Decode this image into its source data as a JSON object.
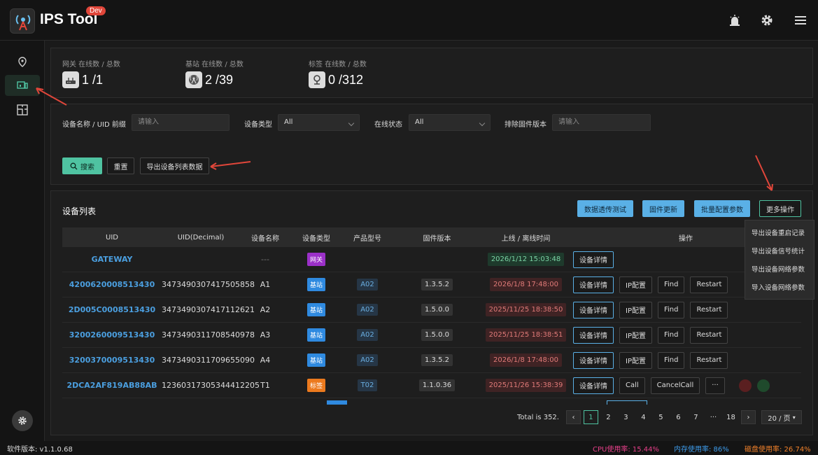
{
  "header": {
    "title": "IPS Tool",
    "badge": "Dev"
  },
  "stats": [
    {
      "label": "网关 在线数 / 总数",
      "value": "1 /1",
      "icon": "router-icon"
    },
    {
      "label": "基站 在线数 / 总数",
      "value": "2 /39",
      "icon": "antenna-icon"
    },
    {
      "label": "标签 在线数 / 总数",
      "value": "0 /312",
      "icon": "location-pin-icon"
    }
  ],
  "filters": {
    "name_label": "设备名称 / UID 前缀",
    "name_placeholder": "请输入",
    "type_label": "设备类型",
    "type_value": "All",
    "status_label": "在线状态",
    "status_value": "All",
    "fw_label": "排除固件版本",
    "fw_placeholder": "请输入",
    "search": "搜索",
    "reset": "重置",
    "export": "导出设备列表数据"
  },
  "table": {
    "title": "设备列表",
    "btn_transparent": "数据透传测试",
    "btn_firmware": "固件更新",
    "btn_batch": "批量配置参数",
    "btn_more": "更多操作",
    "columns": [
      "UID",
      "UID(Decimal)",
      "设备名称",
      "设备类型",
      "产品型号",
      "固件版本",
      "上线 / 离线时间",
      "操作"
    ],
    "rows": [
      {
        "uid": "GATEWAY",
        "dec": "",
        "name": "---",
        "type": "网关",
        "model": "",
        "fw": "",
        "time": "2026/1/12 15:03:48",
        "ops": [
          "设备详情"
        ]
      },
      {
        "uid": "4200620008513430",
        "dec": "3473490307417505858",
        "name": "A1",
        "type": "基站",
        "model": "A02",
        "fw": "1.3.5.2",
        "time": "2026/1/8 17:48:00",
        "ops": [
          "设备详情",
          "IP配置",
          "Find",
          "Restart"
        ]
      },
      {
        "uid": "2D005C0008513430",
        "dec": "3473490307417112621",
        "name": "A2",
        "type": "基站",
        "model": "A02",
        "fw": "1.5.0.0",
        "time": "2025/11/25 18:38:50",
        "ops": [
          "设备详情",
          "IP配置",
          "Find",
          "Restart"
        ]
      },
      {
        "uid": "3200260009513430",
        "dec": "3473490311708540978",
        "name": "A3",
        "type": "基站",
        "model": "A02",
        "fw": "1.5.0.0",
        "time": "2025/11/25 18:38:51",
        "ops": [
          "设备详情",
          "IP配置",
          "Find",
          "Restart"
        ]
      },
      {
        "uid": "3200370009513430",
        "dec": "3473490311709655090",
        "name": "A4",
        "type": "基站",
        "model": "A02",
        "fw": "1.3.5.2",
        "time": "2026/1/8 17:48:00",
        "ops": [
          "设备详情",
          "IP配置",
          "Find",
          "Restart"
        ]
      },
      {
        "uid": "2DCA2AF819AB88AB",
        "dec": "12360317305344412205",
        "name": "T1",
        "type": "标签",
        "model": "T02",
        "fw": "1.1.0.36",
        "time": "2025/11/26 15:38:39",
        "ops": [
          "设备详情",
          "Call",
          "CancelCall",
          "···"
        ]
      }
    ]
  },
  "dropdown": [
    "导出设备重启记录",
    "导出设备信号统计",
    "导出设备网络参数",
    "导入设备网络参数"
  ],
  "pager": {
    "total": "Total is 352.",
    "pages": [
      "1",
      "2",
      "3",
      "4",
      "5",
      "6",
      "7",
      "···",
      "18"
    ],
    "prev": "‹",
    "next": "›",
    "size": "20 / 页"
  },
  "footer": {
    "version": "软件版本:  v1.1.0.68",
    "cpu": "CPU使用率:  15.44%",
    "mem": "内存使用率:  86%",
    "disk": "磁盘使用率:  26.74%"
  },
  "colors": {
    "accent": "#4fc3a1",
    "blue": "#5ab0e6",
    "uid": "#4b9fe0",
    "cpu": "#e83f8a",
    "mem": "#3d9bea",
    "disk": "#f0802a"
  }
}
